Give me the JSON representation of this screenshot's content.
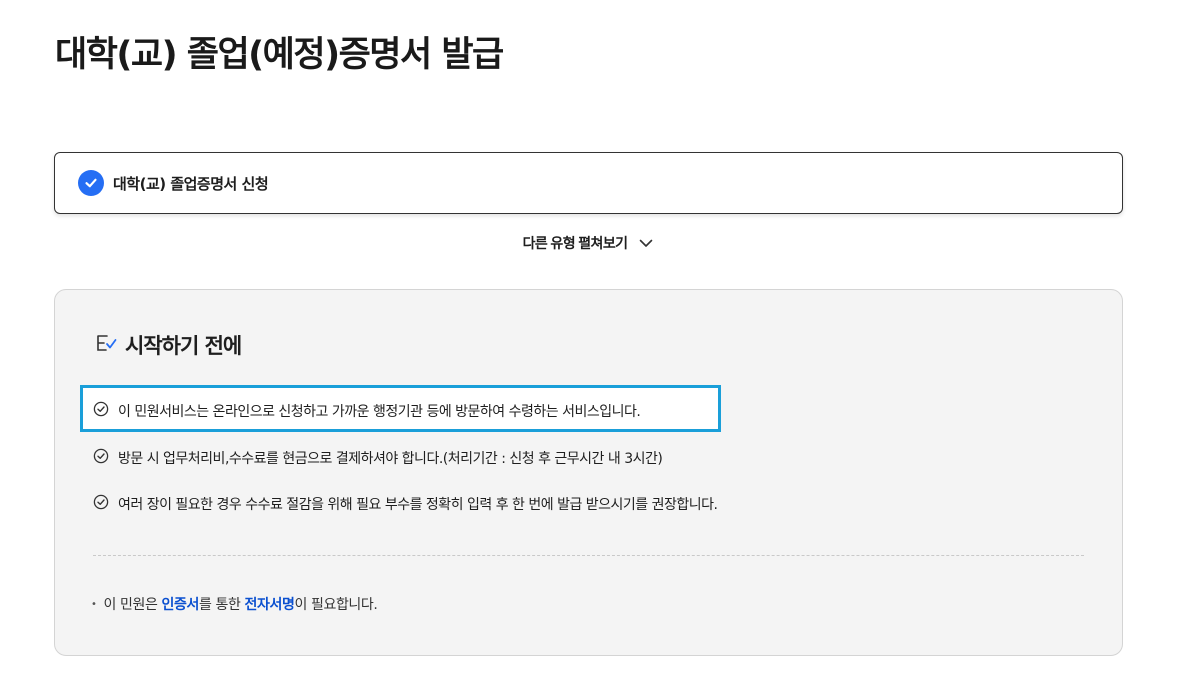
{
  "page": {
    "title": "대학(교) 졸업(예정)증명서 발급"
  },
  "selected_type": {
    "label": "대학(교) 졸업증명서 신청",
    "icon": "check-circle-icon",
    "accent": "#256ef4"
  },
  "expand_types": {
    "label": "다른 유형 펼쳐보기",
    "icon": "chevron-down-icon"
  },
  "before_start": {
    "heading": "시작하기 전에",
    "heading_icon": "checklist-icon",
    "notices": [
      "이 민원서비스는 온라인으로 신청하고 가까운 행정기관 등에 방문하여 수령하는 서비스입니다.",
      "방문 시 업무처리비,수수료를 현금으로 결제하셔야 합니다.(처리기간 : 신청 후 근무시간 내 3시간)",
      "여러 장이 필요한 경우 수수료 절감을 위해 필요 부수를 정확히 입력 후 한 번에 발급 받으시기를 권장합니다."
    ],
    "highlight_color": "#1a9fd9",
    "footnote": {
      "prefix": "이 민원은 ",
      "term1": "인증서",
      "middle": "를 통한 ",
      "term2": "전자서명",
      "suffix": "이 필요합니다."
    },
    "term_color": "#0b50d0"
  }
}
